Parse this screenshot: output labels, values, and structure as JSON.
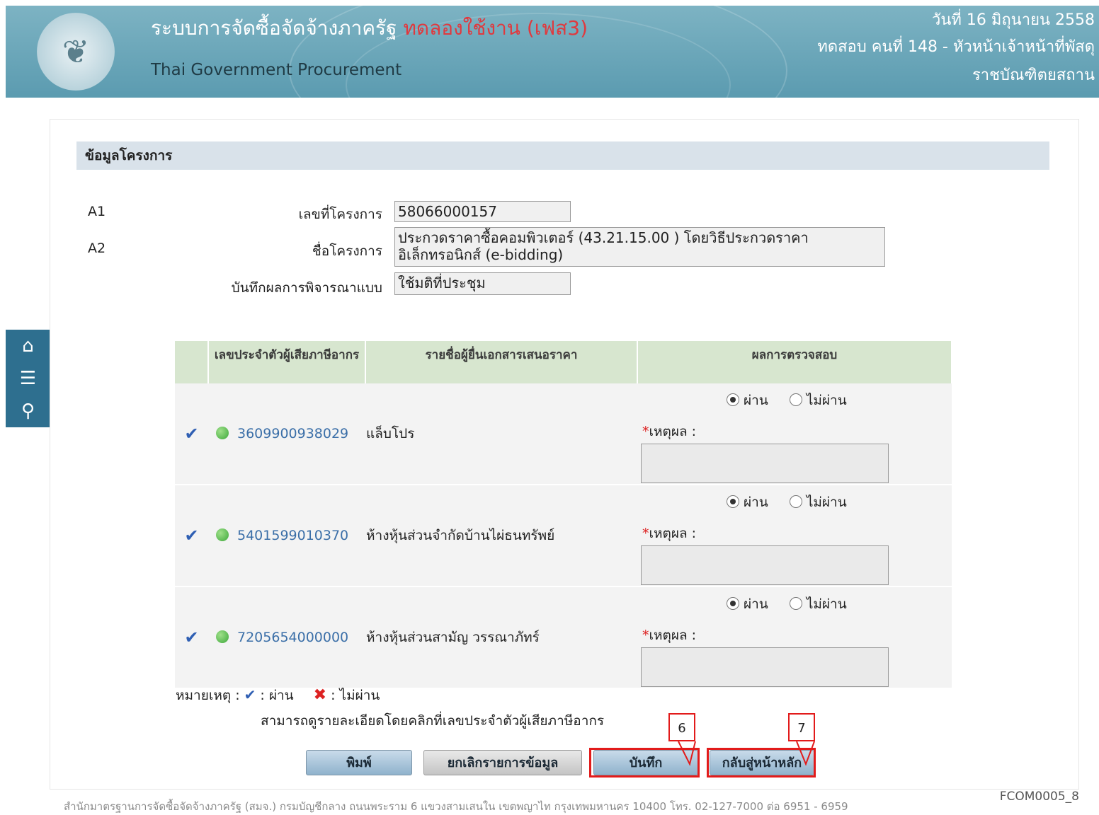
{
  "header": {
    "title_th": "ระบบการจัดซื้อจัดจ้างภาครัฐ",
    "trial_label": "ทดลองใช้งาน (เฟส3)",
    "title_en": "Thai Government Procurement",
    "date": "วันที่ 16 มิถุนายน 2558",
    "user": "ทดสอบ คนที่ 148 - หัวหน้าเจ้าหน้าที่พัสดุ",
    "org": "ราชบัณฑิตยสถาน"
  },
  "section": {
    "title": "ข้อมูลโครงการ"
  },
  "project": {
    "a1_code": "A1",
    "a2_code": "A2",
    "no_label": "เลขที่โครงการ",
    "no_value": "58066000157",
    "name_label": "ชื่อโครงการ",
    "name_line1": "ประกวดราคาซื้อคอมพิวเตอร์ (43.21.15.00 ) โดยวิธีประกวดราคา",
    "name_line2": "อิเล็กทรอนิกส์ (e-bidding)",
    "record_label": "บันทึกผลการพิจารณาแบบ",
    "record_value": "ใช้มติที่ประชุม"
  },
  "table": {
    "headers": [
      "เลขประจำตัวผู้เสียภาษีอากร",
      "รายชื่อผู้ยื่นเอกสารเสนอราคา",
      "ผลการตรวจสอบ"
    ],
    "pass_label": "ผ่าน",
    "fail_label": "ไม่ผ่าน",
    "reason_label": "เหตุผล :",
    "rows": [
      {
        "tax_id": "3609900938029",
        "name": "แล็บโปร"
      },
      {
        "tax_id": "5401599010370",
        "name": "ห้างหุ้นส่วนจำกัดบ้านไผ่ธนทรัพย์"
      },
      {
        "tax_id": "7205654000000",
        "name": "ห้างหุ้นส่วนสามัญ วรรณาภัทร์"
      }
    ]
  },
  "note": {
    "prefix": "หมายเหตุ :",
    "pass": ": ผ่าน",
    "fail": ": ไม่ผ่าน",
    "hint": "สามารถดูรายละเอียดโดยคลิกที่เลขประจำตัวผู้เสียภาษีอากร"
  },
  "buttons": {
    "print": "พิมพ์",
    "cancel": "ยกเลิกรายการข้อมูล",
    "save": "บันทึก",
    "back": "กลับสู่หน้าหลัก"
  },
  "callouts": {
    "save": "6",
    "back": "7"
  },
  "footer": {
    "text": "สำนักมาตรฐานการจัดซื้อจัดจ้างภาครัฐ (สมจ.) กรมบัญชีกลาง ถนนพระราม 6 แขวงสามเสนใน เขตพญาไท กรุงเทพมหานคร 10400 โทร. 02-127-7000 ต่อ 6951 - 6959",
    "code": "FCOM0005_8"
  },
  "colors": {
    "header_bg": "#5b9bb0",
    "table_header_bg": "#d7e6cf",
    "highlight": "#e21b1b"
  }
}
